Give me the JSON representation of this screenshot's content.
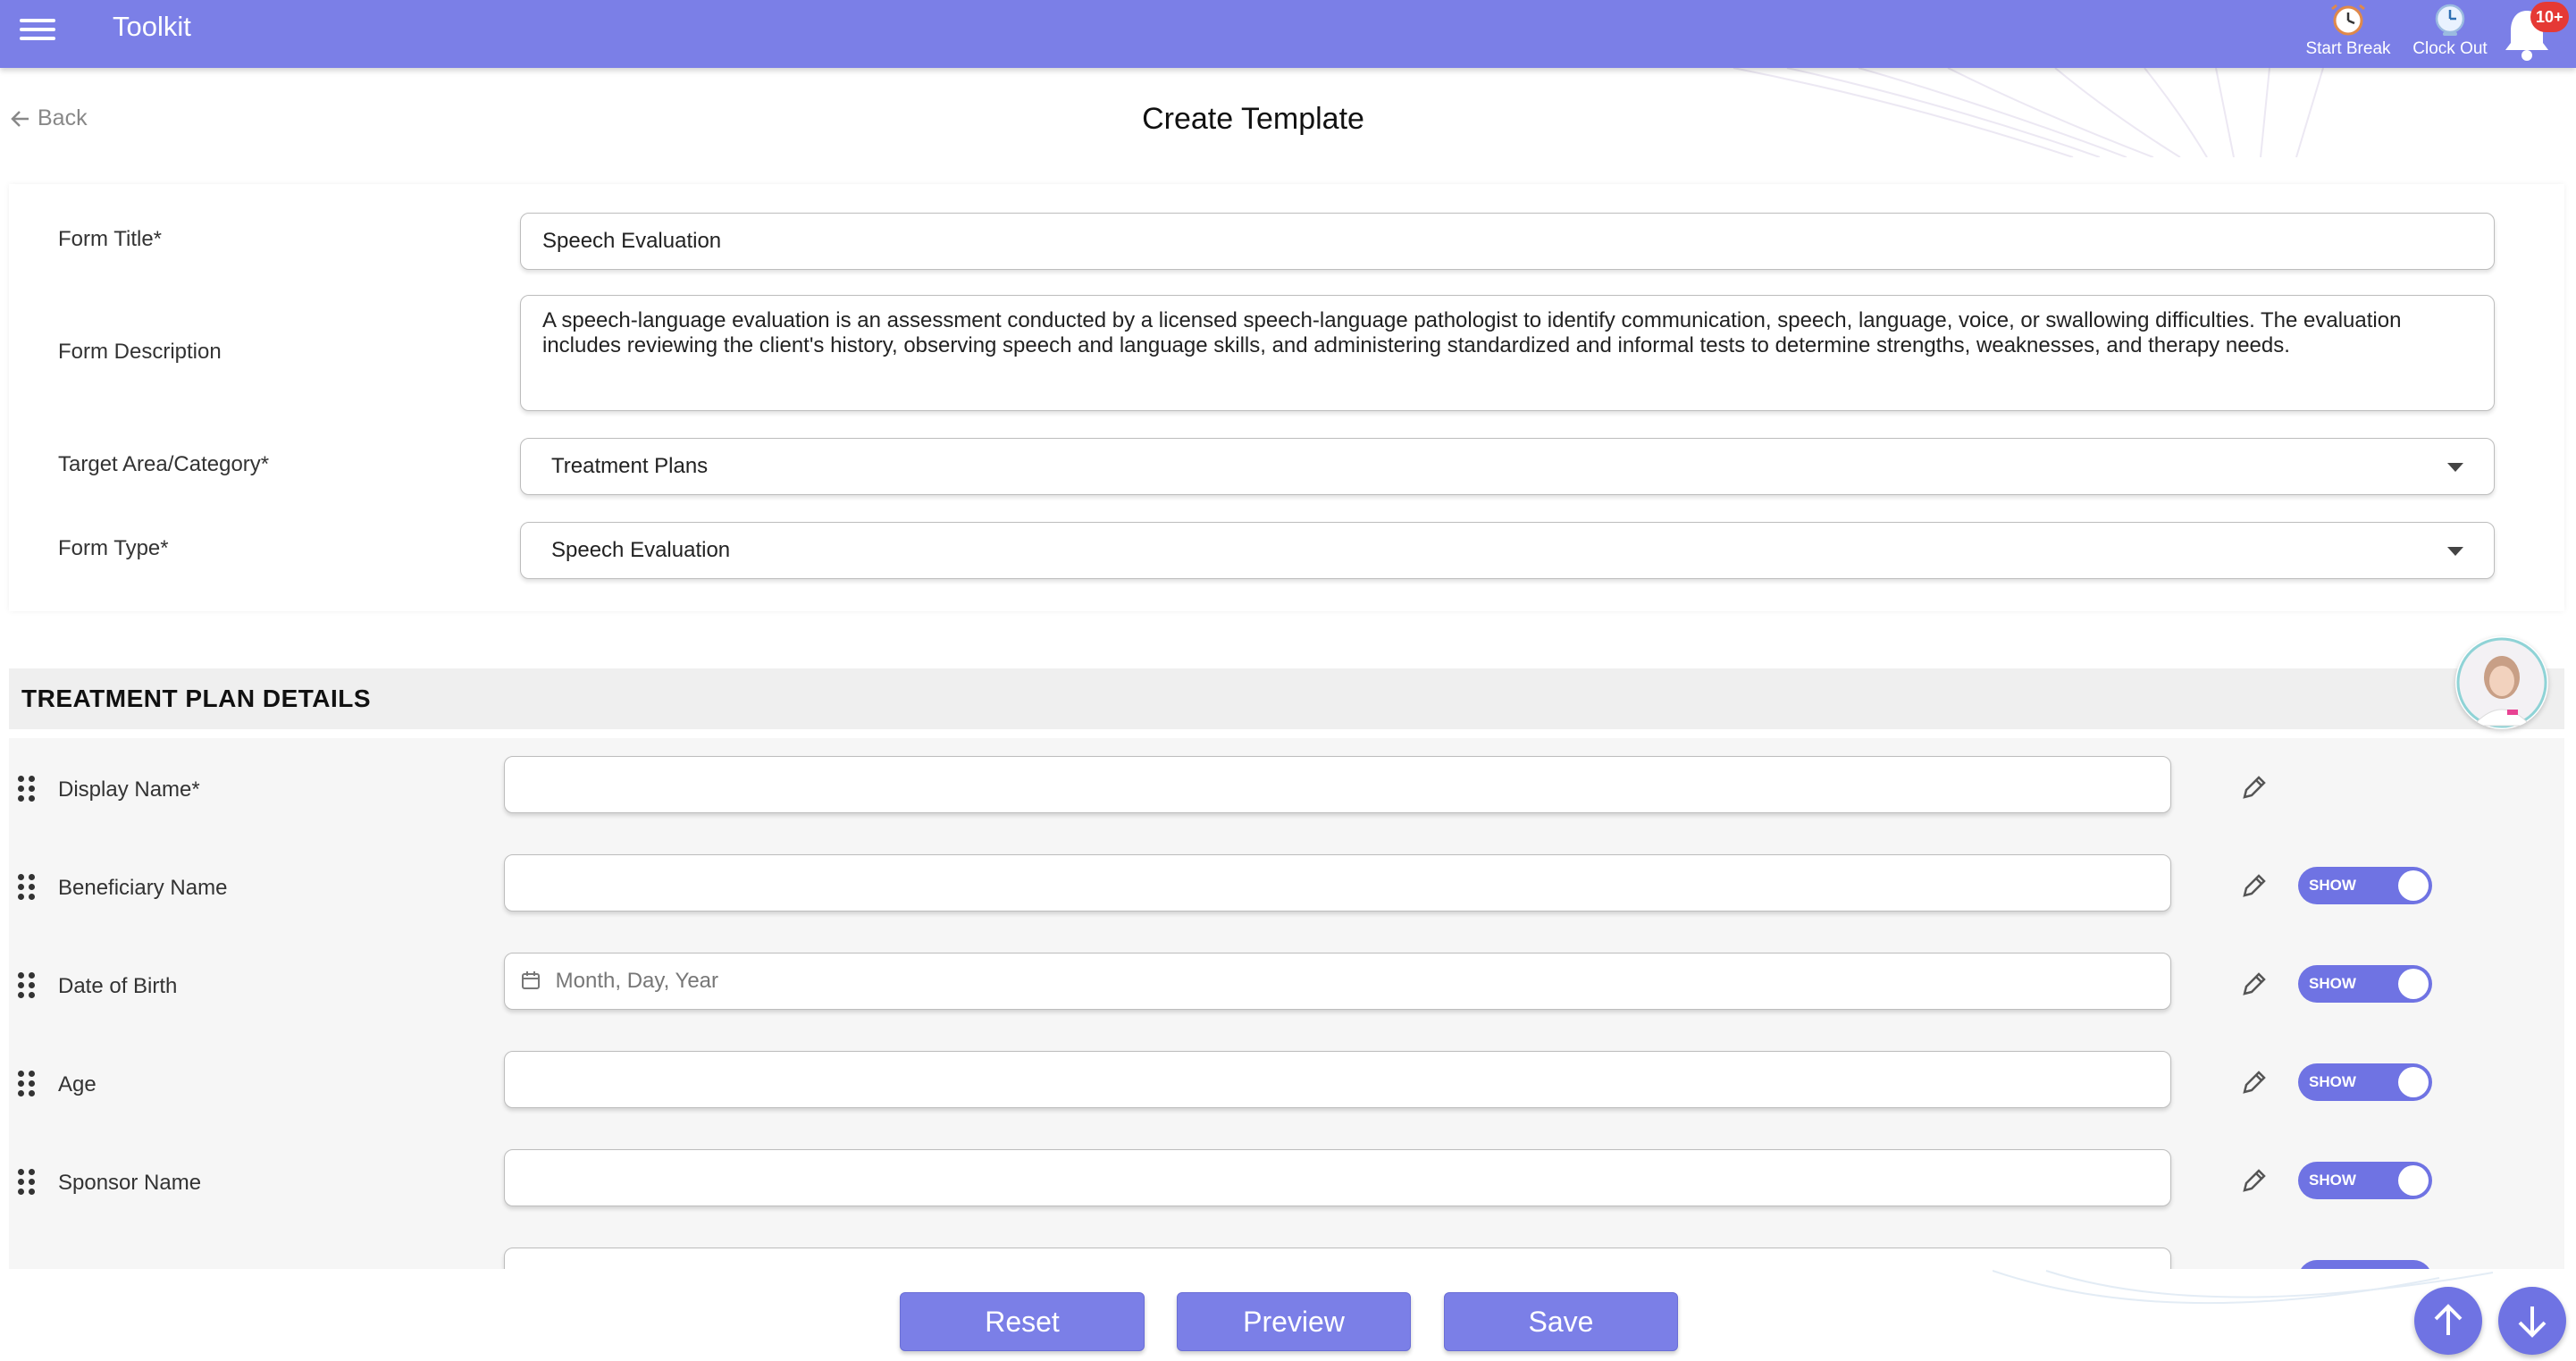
{
  "app": {
    "title": "Toolkit",
    "accent_color": "#7b7fe7"
  },
  "topbar": {
    "start_break_label": "Start Break",
    "clock_out_label": "Clock Out",
    "notification_badge": "10+",
    "icons": [
      "menu-icon",
      "alarm-clock-icon",
      "clock-icon",
      "bell-icon"
    ]
  },
  "header": {
    "back_label": "Back",
    "page_title": "Create Template"
  },
  "form": {
    "title_label": "Form Title*",
    "title_value": "Speech Evaluation",
    "description_label": "Form Description",
    "description_value": "A speech-language evaluation is an assessment conducted by a licensed speech-language pathologist to identify communication, speech, language, voice, or swallowing difficulties. The evaluation includes reviewing the client's history, observing speech and language skills, and administering standardized and informal tests to determine strengths, weaknesses, and therapy needs.",
    "category_label": "Target Area/Category*",
    "category_value": "Treatment Plans",
    "type_label": "Form Type*",
    "type_value": "Speech Evaluation"
  },
  "section": {
    "title": "TREATMENT PLAN DETAILS",
    "rows": [
      {
        "label": "Display Name*",
        "value": "",
        "toggle": null
      },
      {
        "label": "Beneficiary Name",
        "value": "",
        "toggle": "SHOW"
      },
      {
        "label": "Date of Birth",
        "placeholder": "Month, Day, Year",
        "toggle": "SHOW"
      },
      {
        "label": "Age",
        "value": "",
        "toggle": "SHOW"
      },
      {
        "label": "Sponsor Name",
        "value": "",
        "toggle": "SHOW"
      }
    ]
  },
  "actions": {
    "reset_label": "Reset",
    "preview_label": "Preview",
    "save_label": "Save"
  }
}
